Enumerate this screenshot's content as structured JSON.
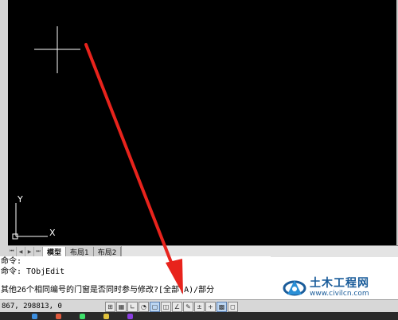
{
  "layout_tabs": [
    {
      "label": "模型",
      "active": true
    },
    {
      "label": "布局1",
      "active": false
    },
    {
      "label": "布局2",
      "active": false
    }
  ],
  "ucs": {
    "y_label": "Y",
    "x_label": "X"
  },
  "command_lines": [
    "命令:",
    "命令: TObjEdit",
    "其他26个相同编号的门窗是否同时参与修改?[全部(A)/部分"
  ],
  "status_bar": {
    "coordinates": "867, 298813, 0",
    "buttons": [
      "snap",
      "grid",
      "ortho",
      "polar",
      "osnap",
      "otrack",
      "ducs",
      "dyn",
      "lwt",
      "qp",
      "model"
    ]
  },
  "watermark": {
    "name": "土木工程网",
    "url": "www.civilcn.com"
  },
  "colors": {
    "canvas": "#000000",
    "crosshair": "#ffffff",
    "arrow": "#e8231c",
    "watermark": "#1a5c9a"
  }
}
